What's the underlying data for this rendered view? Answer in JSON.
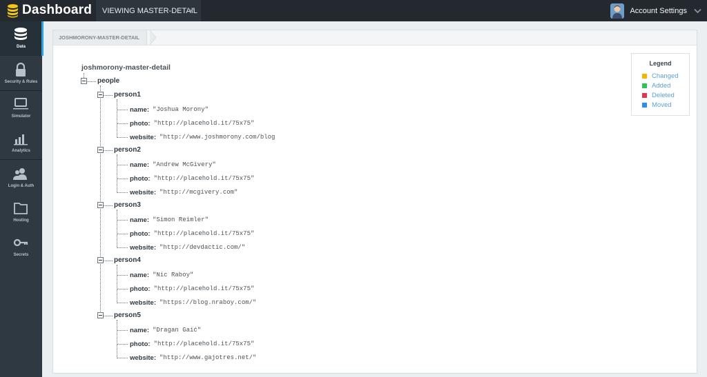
{
  "header": {
    "title": "Dashboard",
    "view_label": "VIEWING MASTER-DETAIL",
    "account_label": "Account Settings"
  },
  "sidebar": {
    "items": [
      {
        "label": "Data",
        "icon": "database-icon",
        "active": true
      },
      {
        "label": "Security & Rules",
        "icon": "lock-icon"
      },
      {
        "label": "Simulator",
        "icon": "laptop-icon"
      },
      {
        "label": "Analytics",
        "icon": "bar-chart-icon"
      },
      {
        "label": "Login & Auth",
        "icon": "users-icon"
      },
      {
        "label": "Hosting",
        "icon": "folder-icon"
      },
      {
        "label": "Secrets",
        "icon": "key-icon"
      }
    ]
  },
  "breadcrumb": {
    "label": "JOSHMORONY-MASTER-DETAIL"
  },
  "legend": {
    "title": "Legend",
    "items": [
      {
        "label": "Changed",
        "color": "#f5b400"
      },
      {
        "label": "Added",
        "color": "#2ec15c"
      },
      {
        "label": "Deleted",
        "color": "#e8344b"
      },
      {
        "label": "Moved",
        "color": "#2a8df0"
      }
    ]
  },
  "tree": {
    "root": "joshmorony-master-detail",
    "people_label": "people",
    "persons": [
      {
        "key": "person1",
        "name": "\"Joshua Morony\"",
        "photo": "\"http://placehold.it/75x75\"",
        "website": "\"http://www.joshmorony.com/blog"
      },
      {
        "key": "person2",
        "name": "\"Andrew McGivery\"",
        "photo": "\"http://placehold.it/75x75\"",
        "website": "\"http://mcgivery.com\""
      },
      {
        "key": "person3",
        "name": "\"Simon Reimler\"",
        "photo": "\"http://placehold.it/75x75\"",
        "website": "\"http://devdactic.com/\""
      },
      {
        "key": "person4",
        "name": "\"Nic Raboy\"",
        "photo": "\"http://placehold.it/75x75\"",
        "website": "\"https://blog.nraboy.com/\""
      },
      {
        "key": "person5",
        "name": "\"Dragan Gaić\"",
        "photo": "\"http://placehold.it/75x75\"",
        "website": "\"http://www.gajotres.net/\""
      }
    ],
    "keys": {
      "name": "name:",
      "photo": "photo:",
      "website": "website:"
    }
  }
}
